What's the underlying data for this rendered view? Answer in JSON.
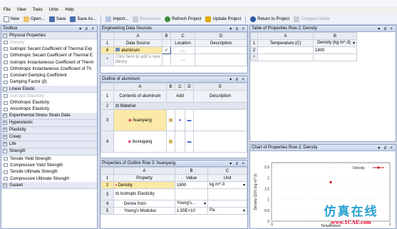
{
  "menu": [
    "File",
    "View",
    "Tools",
    "Units",
    "Help"
  ],
  "toolbar": {
    "new": "New",
    "open": "Open...",
    "save": "Save",
    "save_as": "Save As...",
    "import": "Import...",
    "reconnect": "Reconnect",
    "refresh": "Refresh Project",
    "update": "Update Project",
    "return": "Return to Project",
    "compact": "Compact Mode"
  },
  "toolbox": {
    "title": "Toolbox",
    "groups": [
      {
        "label": "Physical Properties",
        "items": [
          "Density",
          "Isotropic Secant Coefficient of Thermal Exp",
          "Orthotropic Secant Coefficient of Thermal E",
          "Isotropic Instantaneous Coefficient of Therm",
          "Orthotropic Instantaneous Coefficient of Th",
          "Constant Damping Coefficient",
          "Damping Factor (β)"
        ]
      },
      {
        "label": "Linear Elastic",
        "items": [
          "Isotropic Elasticity",
          "Orthotropic Elasticity",
          "Anisotropic Elasticity"
        ]
      },
      {
        "label": "Experimental Stress Strain Data",
        "items": []
      },
      {
        "label": "Hyperelastic",
        "items": []
      },
      {
        "label": "Plasticity",
        "items": []
      },
      {
        "label": "Creep",
        "items": []
      },
      {
        "label": "Life",
        "items": []
      },
      {
        "label": "Strength",
        "items": [
          "Tensile Yield Strength",
          "Compressive Yield Strength",
          "Tensile Ultimate Strength",
          "Compressive Ultimate Strength"
        ]
      },
      {
        "label": "Gasket",
        "items": []
      }
    ]
  },
  "eds": {
    "title": "Engineering Data Sources",
    "cols": [
      "A",
      "B",
      "C",
      "D"
    ],
    "headers": [
      "Data Source",
      "",
      "Location",
      "Description"
    ],
    "rows": [
      {
        "n": "8",
        "source": "aluminum"
      },
      {
        "n": "*",
        "source": "Click here to add a new library"
      }
    ]
  },
  "outline": {
    "title": "Outline of aluminum",
    "cols": [
      "A",
      "B",
      "C",
      "D",
      "E"
    ],
    "headers": [
      "Contents of aluminum",
      "Add",
      "",
      "",
      "Description"
    ],
    "rows": [
      {
        "n": "2",
        "name": "Material"
      },
      {
        "n": "3",
        "name": "huanyang"
      },
      {
        "n": "4",
        "name": "buxiugang"
      }
    ]
  },
  "props": {
    "title": "Properties of Outline Row 3: huanyang",
    "cols": [
      "A",
      "B",
      "C"
    ],
    "headers": [
      "Property",
      "Value",
      "Unit"
    ],
    "rows": [
      {
        "n": "2",
        "prop": "Density",
        "value": "1800",
        "unit": "kg m^-3"
      },
      {
        "n": "3",
        "prop": "Isotropic Elasticity",
        "value": "",
        "unit": ""
      },
      {
        "n": "4",
        "prop": "Derive from",
        "value": "Young's...",
        "unit": ""
      },
      {
        "n": "5",
        "prop": "Young's Modulus",
        "value": "1.55E+10",
        "unit": "Pa"
      }
    ]
  },
  "table": {
    "title": "Table of Properties Row 2: Density",
    "cols": [
      "A",
      "B"
    ],
    "headers": [
      "Temperature (C)",
      "Density (kg m^-3)"
    ],
    "rows": [
      {
        "n": "2",
        "temp": "",
        "density": "1800"
      },
      {
        "n": "*",
        "temp": "",
        "density": ""
      }
    ]
  },
  "chart": {
    "title": "Chart of Properties Row 2: Density"
  },
  "chart_data": {
    "type": "scatter",
    "ylabel": "Density (10³) (kg m^-3)",
    "xlabel": "Temperature",
    "legend": [
      "Density"
    ],
    "y_ticks": [
      "2.5",
      "2",
      "1.5",
      "1",
      "0.5",
      "0"
    ],
    "x_ticks": [
      "-1",
      "0",
      "1"
    ],
    "xlim": [
      -1,
      1
    ],
    "ylim": [
      0,
      2.7
    ],
    "series": [
      {
        "name": "Density",
        "x": [
          0
        ],
        "y": [
          1.8
        ],
        "color": "#cc1111"
      }
    ]
  },
  "watermark": {
    "line1": "仿真在线",
    "line2": "www.1CAE.com"
  }
}
